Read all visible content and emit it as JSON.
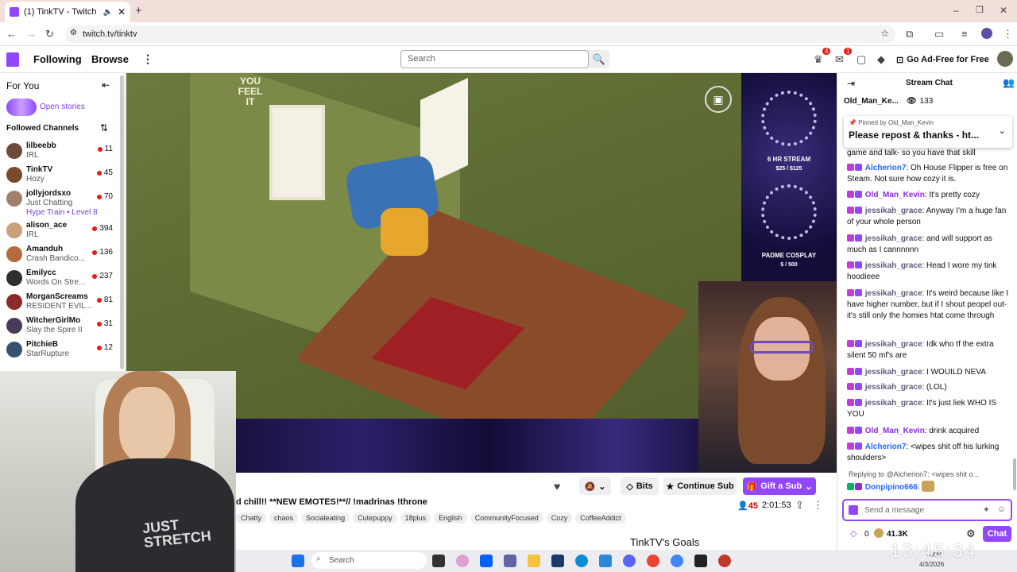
{
  "browser": {
    "tab_title": "(1) TinkTV - Twitch",
    "url": "twitch.tv/tinktv"
  },
  "nav": {
    "following": "Following",
    "browse": "Browse",
    "search_placeholder": "Search",
    "inbox_count": "4",
    "notif_count": "1",
    "ad_free": "Go Ad-Free for Free"
  },
  "sidebar": {
    "for_you": "For You",
    "open_stories": "Open stories",
    "followed_header": "Followed Channels",
    "channels": [
      {
        "name": "lilbeebb",
        "game": "IRL",
        "viewers": "11",
        "color": "#6b4c3b"
      },
      {
        "name": "TinkTV",
        "game": "Hozy",
        "viewers": "45",
        "color": "#7a4a2c"
      },
      {
        "name": "jollyjordsxo",
        "game": "Just Chatting",
        "extra": "Hype Train • Level 8",
        "viewers": "70",
        "color": "#a0806b"
      },
      {
        "name": "alison_ace",
        "game": "IRL",
        "viewers": "394",
        "color": "#c9a07a"
      },
      {
        "name": "Amanduh",
        "game": "Crash Bandico...",
        "viewers": "136",
        "color": "#b5693e"
      },
      {
        "name": "Emilycc",
        "game": "Words On Stre...",
        "viewers": "237",
        "color": "#2f2f33"
      },
      {
        "name": "MorganScreams",
        "game": "RESIDENT EVIL...",
        "viewers": "81",
        "color": "#8a2a2a"
      },
      {
        "name": "WitcherGirlMo",
        "game": "Slay the Spire II",
        "viewers": "31",
        "color": "#4a3a5a"
      },
      {
        "name": "PitchieB",
        "game": "StarRupture",
        "viewers": "12",
        "color": "#3a5070"
      }
    ]
  },
  "video": {
    "stream_overlay_1_title": "6 HR STREAM",
    "stream_overlay_1_value": "$25 / $125",
    "stream_overlay_2_title": "PADME COSPLAY",
    "stream_overlay_2_value": "$ / 500",
    "sign_text": "YOU FEEL IT",
    "shirt_text": "JUST STRETCH"
  },
  "info": {
    "title": "d chill!! **NEW EMOTES!**// !madrinas !throne",
    "tags": [
      "Chatty",
      "chaos",
      "Socialeating",
      "Cutepuppy",
      "18plus",
      "English",
      "CommunityFocused",
      "Cozy",
      "CoffeeAddict"
    ],
    "viewers": "45",
    "uptime": "2:01:53",
    "bits": "Bits",
    "continue_sub": "Continue Sub",
    "gift_sub": "Gift a Sub",
    "goals": "TinkTV's Goals"
  },
  "chat": {
    "header": "Stream Chat",
    "top_user": "Old_Man_Ke...",
    "top_count": "133",
    "pinned_by_prefix": "Pinned by",
    "pinned_by": "Old_Man_Kevin",
    "pinned_text": "Please repost & thanks - ht...",
    "messages": [
      {
        "user": "",
        "text": "game and talk- so you have that skill",
        "color": "#0e0e10"
      },
      {
        "user": "Alcherion7",
        "text": ": Oh House Flipper is free on Steam. Not sure how cozy it is.",
        "color": "#1e69ff"
      },
      {
        "user": "Old_Man_Kevin",
        "text": ": It's pretty cozy",
        "color": "#8a2be2"
      },
      {
        "user": "jessikah_grace",
        "text": ": Anyway I'm a huge fan of your whole person",
        "color": "#5c5c7a"
      },
      {
        "user": "jessikah_grace",
        "text": ": and will support as much as I cannnnnn",
        "color": "#5c5c7a"
      },
      {
        "user": "jessikah_grace",
        "text": ": Head I wore my tink hoodieee",
        "color": "#5c5c7a"
      },
      {
        "user": "jessikah_grace",
        "text": ": It's weird because like I have higher number, but if I shout peopel out- it's still only the homies htat come through",
        "color": "#5c5c7a"
      },
      {
        "user": "jessikah_grace",
        "text": ": Idk who tf the extra silent 50 mf's are",
        "color": "#5c5c7a"
      },
      {
        "user": "jessikah_grace",
        "text": ": I WOUILD NEVA",
        "color": "#5c5c7a"
      },
      {
        "user": "jessikah_grace",
        "text": ": (LOL)",
        "color": "#5c5c7a"
      },
      {
        "user": "jessikah_grace",
        "text": ": It's just liek WHO IS YOU",
        "color": "#5c5c7a"
      },
      {
        "user": "Old_Man_Kevin",
        "text": ": drink acquired",
        "color": "#8a2be2"
      },
      {
        "user": "Alcherion7",
        "text": ": <wipes shit off his lurking shoulders>",
        "color": "#1e69ff"
      }
    ],
    "reply_text": "Replying to @Alcherion7: <wipes shit o...",
    "last_user": "Donpipino666",
    "input_placeholder": "Send a message",
    "points": "0",
    "channel_points": "41.3K",
    "chat_btn": "Chat"
  },
  "taskbar": {
    "search": "Search",
    "time": "13:45:34",
    "time_small": "4 AM",
    "date": "4/3/2026"
  }
}
